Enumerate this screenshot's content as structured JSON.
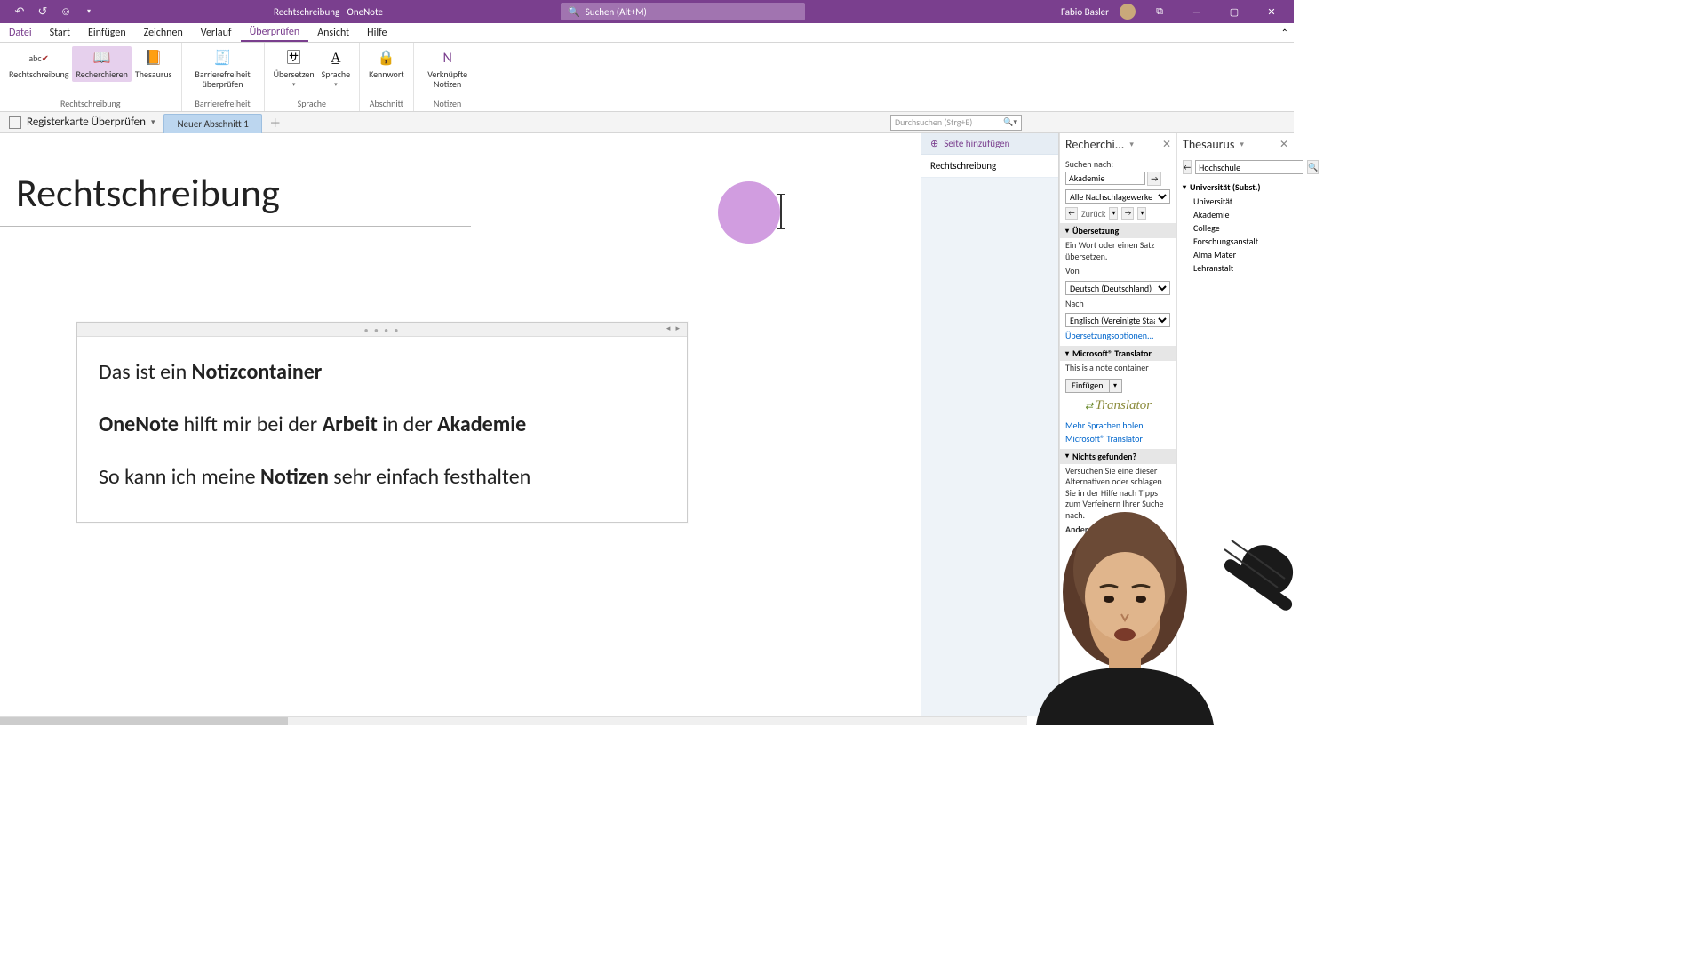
{
  "titlebar": {
    "doc_title": "Rechtschreibung  -  OneNote",
    "search_placeholder": "Suchen (Alt+M)",
    "user_name": "Fabio Basler"
  },
  "menu": {
    "file": "Datei",
    "start": "Start",
    "insert": "Einfügen",
    "draw": "Zeichnen",
    "history": "Verlauf",
    "review": "Überprüfen",
    "view": "Ansicht",
    "help": "Hilfe"
  },
  "ribbon": {
    "spelling": "Rechtschreibung",
    "research": "Recherchieren",
    "thesaurus": "Thesaurus",
    "group_spelling": "Rechtschreibung",
    "accessibility": "Barrierefreiheit überprüfen",
    "group_accessibility": "Barrierefreiheit",
    "translate": "Übersetzen",
    "language": "Sprache",
    "group_language": "Sprache",
    "password": "Kennwort",
    "group_section": "Abschnitt",
    "linked_notes": "Verknüpfte Notizen",
    "group_notes": "Notizen"
  },
  "notebook": {
    "label": "Registerkarte Überprüfen",
    "section_tab": "Neuer Abschnitt 1",
    "search_placeholder": "Durchsuchen (Strg+E)"
  },
  "pagelist": {
    "add_page": "Seite hinzufügen",
    "page1": "Rechtschreibung"
  },
  "page": {
    "title": "Rechtschreibung",
    "line1_pre": "Das ist ein ",
    "line1_b": "Notizcontainer",
    "line2_b1": "OneNote",
    "line2_mid1": " hilft mir bei der ",
    "line2_b2": "Arbeit",
    "line2_mid2": " in der ",
    "line2_b3": "Akademie",
    "line3_pre": "So kann ich meine ",
    "line3_b": "Notizen",
    "line3_post": " sehr einfach festhalten"
  },
  "research_pane": {
    "title": "Recherchi...",
    "search_label": "Suchen nach:",
    "search_value": "Akademie",
    "source_value": "Alle Nachschlagewerke",
    "back_label": "Zurück",
    "sec_translate": "Übersetzung",
    "translate_hint": "Ein Wort oder einen Satz übersetzen.",
    "from_label": "Von",
    "from_value": "Deutsch (Deutschland)",
    "to_label": "Nach",
    "to_value": "Englisch (Vereinigte Staaten)",
    "translate_options": "Übersetzungsoptionen...",
    "sec_translator": "Microsoft® Translator",
    "note_container": "This is a note container",
    "insert_btn": "Einfügen",
    "translator_name": "Translator",
    "more_langs": "Mehr Sprachen holen",
    "ms_translator_link": "Microsoft® Translator",
    "sec_notfound": "Nichts gefunden?",
    "notfound_hint": "Versuchen Sie eine dieser Alternativen oder schlagen Sie in der Hilfe nach Tipps zum Verfeinern Ihrer Suche nach.",
    "other_label": "Andere Nachsc..."
  },
  "thesaurus_pane": {
    "title": "Thesaurus",
    "search_value": "Hochschule",
    "category": "Universität (Subst.)",
    "items": [
      "Universität",
      "Akademie",
      "College",
      "Forschungsanstalt",
      "Alma Mater",
      "Lehranstalt"
    ]
  }
}
